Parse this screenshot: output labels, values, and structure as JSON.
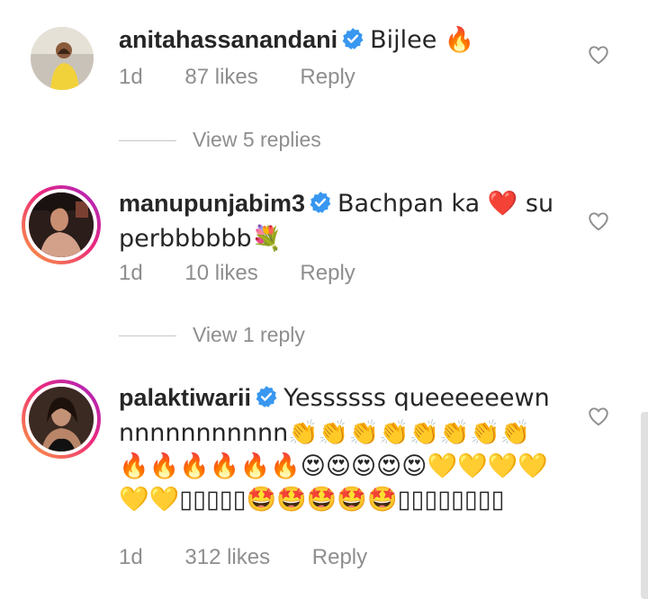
{
  "comments": [
    {
      "username": "anitahassanandani",
      "text": "Bijlee 🔥",
      "time": "1d",
      "likes": "87 likes",
      "reply": "Reply",
      "view_replies": "View 5 replies"
    },
    {
      "username": "manupunjabim3",
      "text": "Bachpan ka ❤️ superbbbbbb💐",
      "time": "1d",
      "likes": "10 likes",
      "reply": "Reply",
      "view_replies": "View 1 reply"
    },
    {
      "username": "palaktiwarii",
      "text": "Yessssss queeeeeewnnnnnnnnnnnn👏👏👏👏👏👏👏👏🔥🔥🔥🔥🔥🔥😍😍😍😍😍💛💛💛💛💛💛▯▯▯▯▯🤩🤩🤩🤩🤩▯▯▯▯▯▯▯▯",
      "time": "1d",
      "likes": "312 likes",
      "reply": "Reply"
    }
  ],
  "icons": {
    "verified": "verified-badge-icon",
    "like": "heart-outline-icon"
  },
  "colors": {
    "verified_blue": "#3897f0",
    "meta_gray": "#8e8e8e"
  }
}
